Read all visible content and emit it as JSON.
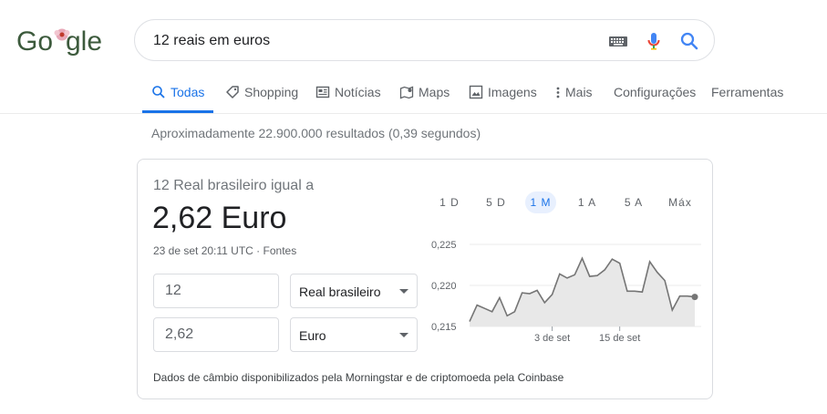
{
  "logo": {
    "alt": "Google"
  },
  "search": {
    "query": "12 reais em euros"
  },
  "tabs": [
    {
      "label": "Todas",
      "icon": "search-icon"
    },
    {
      "label": "Shopping",
      "icon": "tag-icon"
    },
    {
      "label": "Notícias",
      "icon": "news-icon"
    },
    {
      "label": "Maps",
      "icon": "map-icon"
    },
    {
      "label": "Imagens",
      "icon": "image-icon"
    },
    {
      "label": "Mais",
      "icon": "more-vert-icon"
    },
    {
      "label": "Configurações"
    },
    {
      "label": "Ferramentas"
    }
  ],
  "active_tab": "Todas",
  "stats": "Aproximadamente 22.900.000 resultados (0,39 segundos)",
  "converter": {
    "equals_label": "12 Real brasileiro igual a",
    "result": "2,62 Euro",
    "timestamp": "23 de set 20:11 UTC · ",
    "sources_link": "Fontes",
    "from_amount": "12",
    "from_currency": "Real brasileiro",
    "to_amount": "2,62",
    "to_currency": "Euro",
    "footnote": "Dados de câmbio disponibilizados pela Morningstar e de criptomoeda pela Coinbase"
  },
  "ranges": [
    "1 D",
    "5 D",
    "1 M",
    "1 A",
    "5 A",
    "Máx"
  ],
  "active_range": "1 M",
  "accent_color": "#1a73e8",
  "chart_data": {
    "type": "area",
    "y_ticks": [
      "0,225",
      "0,220",
      "0,215"
    ],
    "y_tick_values": [
      0.225,
      0.22,
      0.215
    ],
    "ylim": [
      0.215,
      0.225
    ],
    "x_tick_labels": [
      {
        "label": "3 de set",
        "index": 11
      },
      {
        "label": "15 de set",
        "index": 20
      }
    ],
    "values": [
      0.2156,
      0.2176,
      0.2172,
      0.2168,
      0.2185,
      0.2163,
      0.2168,
      0.2191,
      0.219,
      0.2194,
      0.2179,
      0.2189,
      0.2214,
      0.2209,
      0.2213,
      0.2233,
      0.2211,
      0.2212,
      0.2219,
      0.2232,
      0.2227,
      0.2193,
      0.2193,
      0.2192,
      0.2229,
      0.2216,
      0.2206,
      0.217,
      0.2187,
      0.2187,
      0.2186
    ],
    "line_color": "#757575",
    "fill_color": "#e8e8e8",
    "grid": true
  }
}
